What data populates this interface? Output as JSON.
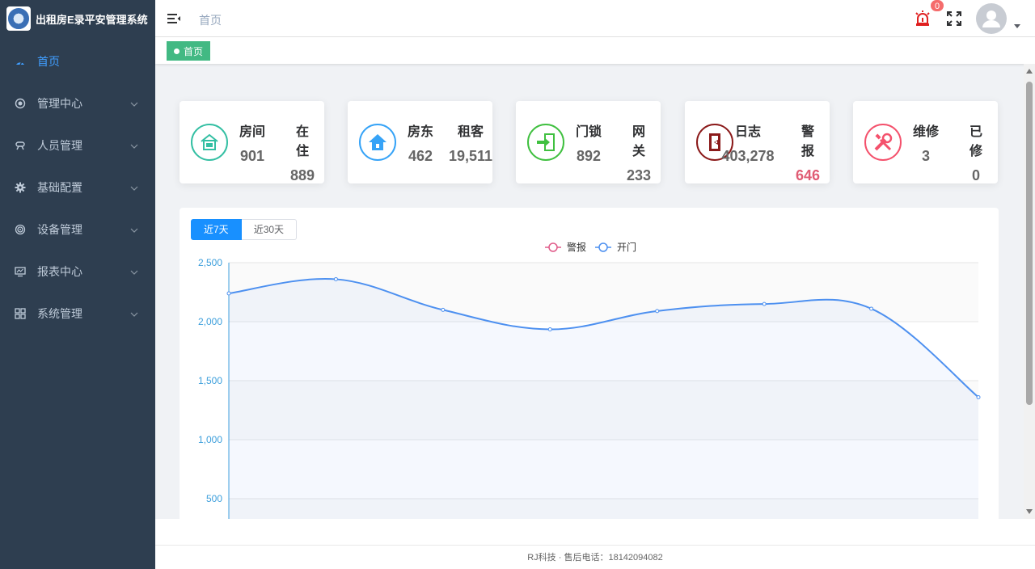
{
  "app": {
    "title": "出租房E录平安管理系统"
  },
  "sidebar": {
    "items": [
      {
        "label": "首页",
        "icon": "dashboard-icon",
        "active": true,
        "arrow": false
      },
      {
        "label": "管理中心",
        "icon": "target-icon",
        "active": false,
        "arrow": true
      },
      {
        "label": "人员管理",
        "icon": "people-icon",
        "active": false,
        "arrow": true
      },
      {
        "label": "基础配置",
        "icon": "gear-icon",
        "active": false,
        "arrow": true
      },
      {
        "label": "设备管理",
        "icon": "device-icon",
        "active": false,
        "arrow": true
      },
      {
        "label": "报表中心",
        "icon": "monitor-icon",
        "active": false,
        "arrow": true
      },
      {
        "label": "系统管理",
        "icon": "grid-icon",
        "active": false,
        "arrow": true
      }
    ]
  },
  "header": {
    "breadcrumb": "首页",
    "alarm_count": "0"
  },
  "tags": {
    "active": "首页"
  },
  "stats": [
    {
      "icon": "room-icon",
      "color": "#34bfa3",
      "labels": [
        "房间",
        "在住"
      ],
      "values": [
        "901",
        "889"
      ]
    },
    {
      "icon": "house-icon",
      "color": "#36a3f7",
      "labels": [
        "房东",
        "租客"
      ],
      "values": [
        "462",
        "19,511"
      ]
    },
    {
      "icon": "lock-icon",
      "color": "#40c040",
      "labels": [
        "门锁",
        "网关"
      ],
      "values": [
        "892",
        "233"
      ]
    },
    {
      "icon": "door-icon",
      "color": "#8b1a1a",
      "labels": [
        "日志",
        "警报"
      ],
      "values": [
        "403,278",
        "646"
      ]
    },
    {
      "icon": "repair-icon",
      "color": "#f4516c",
      "labels": [
        "维修",
        "已修"
      ],
      "values": [
        "3",
        "0"
      ]
    }
  ],
  "chart": {
    "range_tabs": [
      "近7天",
      "近30天"
    ],
    "active_tab": "近7天"
  },
  "chart_data": {
    "type": "line",
    "title": "",
    "legend": [
      "警报",
      "开门"
    ],
    "legend_position": "top-center",
    "colors": {
      "警报": "#e05c8a",
      "开门": "#4d90f0"
    },
    "ylim": [
      0,
      2500
    ],
    "yticks": [
      "2,500",
      "2,000",
      "1,500",
      "1,000",
      "500"
    ],
    "grid": true,
    "series": [
      {
        "name": "开门",
        "values": [
          2240,
          2360,
          2100,
          1935,
          2090,
          2150,
          2110,
          1360
        ]
      }
    ]
  },
  "footer": {
    "text": "RJ科技 · 售后电话：18142094082"
  }
}
